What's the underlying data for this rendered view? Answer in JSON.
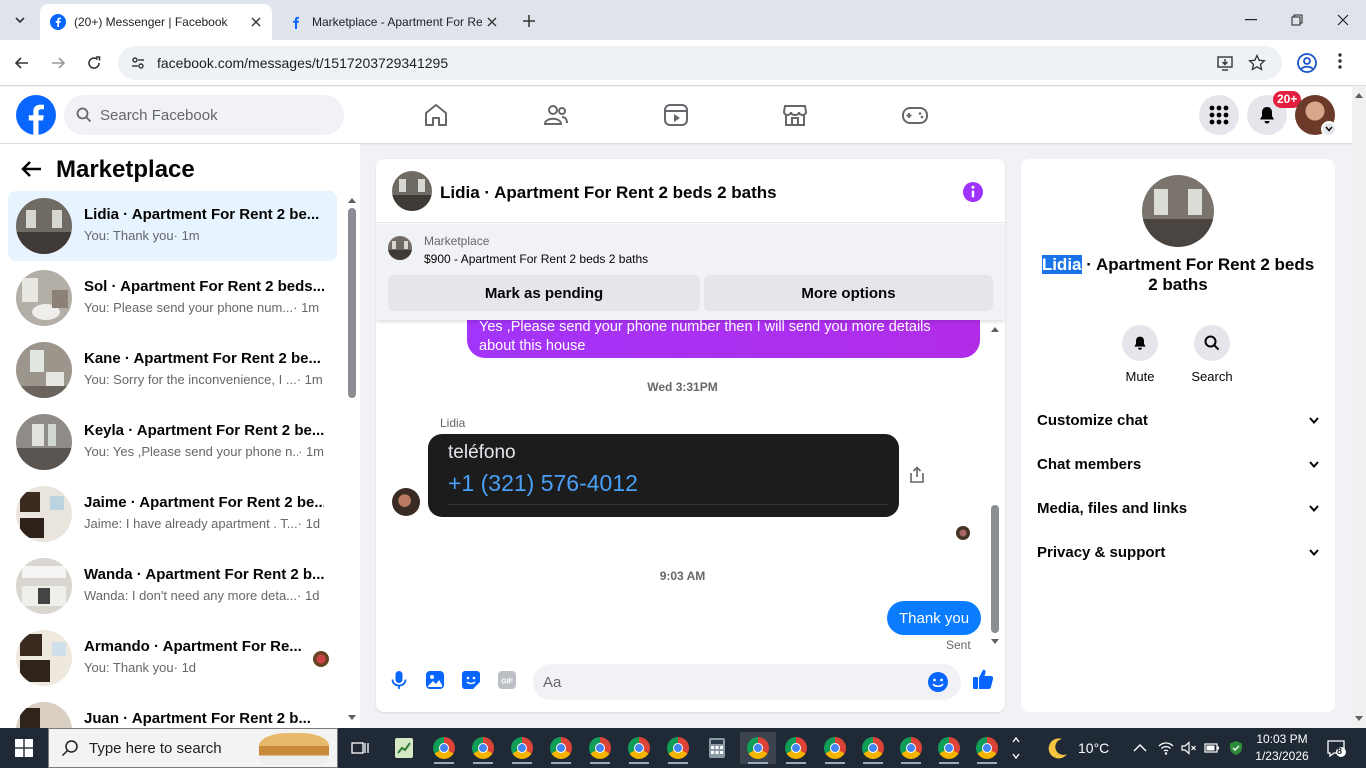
{
  "browser": {
    "tabs": [
      {
        "title": "(20+) Messenger | Facebook",
        "active": true
      },
      {
        "title": "Marketplace - Apartment For Re",
        "active": false
      }
    ],
    "url": "facebook.com/messages/t/1517203729341295"
  },
  "fb": {
    "search_placeholder": "Search Facebook",
    "notifications_badge": "20+",
    "brand_color": "#0866ff"
  },
  "left_panel": {
    "title": "Marketplace",
    "conversations": [
      {
        "name": "Lidia · Apartment For Rent 2 be...",
        "snippet": "You: Thank you",
        "time": " · 1m",
        "selected": true
      },
      {
        "name": "Sol · Apartment For Rent 2 beds...",
        "snippet": "You: Please send your phone num...",
        "time": " · 1m"
      },
      {
        "name": "Kane · Apartment For Rent 2 be...",
        "snippet": "You: Sorry for the inconvenience, I ...",
        "time": " · 1m"
      },
      {
        "name": "Keyla · Apartment For Rent 2 be...",
        "snippet": "You: Yes ,Please send your phone n...",
        "time": " · 1m"
      },
      {
        "name": "Jaime · Apartment For Rent 2 be...",
        "snippet": "Jaime: I have already apartment . T...",
        "time": " · 1d"
      },
      {
        "name": "Wanda · Apartment For Rent 2 b...",
        "snippet": "Wanda: I don't need any more deta...",
        "time": " · 1d"
      },
      {
        "name": "Armando · Apartment For Re...",
        "snippet": "You: Thank you",
        "time": " · 1d"
      },
      {
        "name": "Juan · Apartment For Rent 2 b...",
        "snippet": "",
        "time": ""
      }
    ]
  },
  "chat": {
    "title": "Lidia · Apartment For Rent 2 beds 2 baths",
    "marketplace_label": "Marketplace",
    "listing": "$900 - Apartment For Rent 2 beds 2 baths",
    "mark_pending": "Mark as pending",
    "more_options": "More options",
    "messages": {
      "out_top": "Yes ,Please send your phone number then I will send you more details about this house",
      "ts1": "Wed 3:31PM",
      "sender": "Lidia",
      "card_line1": "teléfono",
      "card_line2": "+1 (321) 576-4012",
      "ts2": "9:03 AM",
      "out_last": "Thank you",
      "sent": "Sent"
    },
    "composer_placeholder": "Aa"
  },
  "right_panel": {
    "name_highlight": "Lidia",
    "name_rest": " · Apartment For Rent 2 beds 2 baths",
    "actions": [
      "Mute",
      "Search"
    ],
    "sections": [
      "Customize chat",
      "Chat members",
      "Media, files and links",
      "Privacy & support"
    ]
  },
  "taskbar": {
    "search_placeholder": "Type here to search",
    "temperature": "10°C",
    "time": "10:03 PM",
    "date": "1/23/2026",
    "notification_count": "8"
  }
}
